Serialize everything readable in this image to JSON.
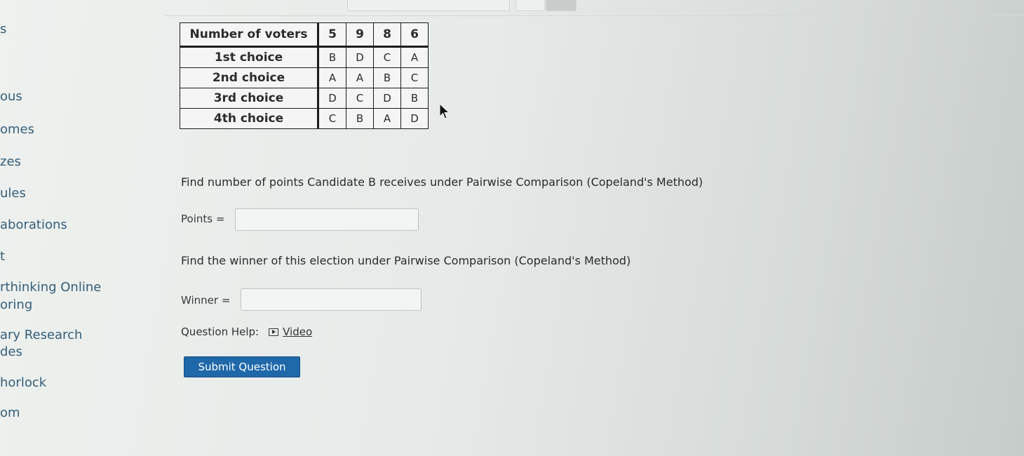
{
  "sidebar": {
    "items": [
      {
        "label": "s"
      },
      {
        "label": "ous"
      },
      {
        "label": "omes"
      },
      {
        "label": "zes"
      },
      {
        "label": "ules"
      },
      {
        "label": "aborations"
      },
      {
        "label": "t"
      },
      {
        "label": "rthinking Online"
      },
      {
        "label": "oring"
      },
      {
        "label": "ary Research"
      },
      {
        "label": "des"
      },
      {
        "label": "horlock"
      },
      {
        "label": "om"
      }
    ]
  },
  "table": {
    "header_label": "Number of voters",
    "voters": [
      "5",
      "9",
      "8",
      "6"
    ],
    "rows": [
      {
        "label": "1st choice",
        "values": [
          "B",
          "D",
          "C",
          "A"
        ]
      },
      {
        "label": "2nd choice",
        "values": [
          "A",
          "A",
          "B",
          "C"
        ]
      },
      {
        "label": "3rd choice",
        "values": [
          "D",
          "C",
          "D",
          "B"
        ]
      },
      {
        "label": "4th choice",
        "values": [
          "C",
          "B",
          "A",
          "D"
        ]
      }
    ]
  },
  "question1": {
    "text": "Find number of points Candidate B receives under Pairwise Comparison (Copeland's Method)",
    "field_label": "Points =",
    "value": ""
  },
  "question2": {
    "text": "Find the winner of this election under Pairwise Comparison (Copeland's Method)",
    "field_label": "Winner =",
    "value": ""
  },
  "help": {
    "label": "Question Help:",
    "video_label": "Video",
    "video_icon": "video-icon"
  },
  "submit_label": "Submit Question",
  "colors": {
    "submit_bg": "#1f68a9",
    "sidebar_link": "#355e7a"
  }
}
